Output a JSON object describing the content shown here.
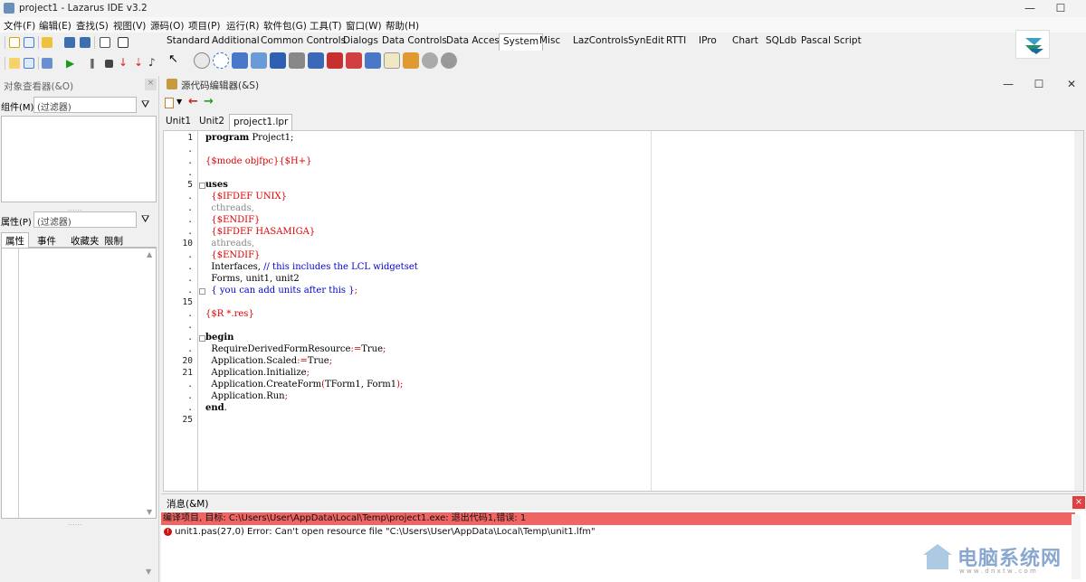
{
  "window": {
    "title": "project1 - Lazarus IDE v3.2"
  },
  "menu": [
    "文件(F)",
    "编辑(E)",
    "查找(S)",
    "视图(V)",
    "源码(O)",
    "项目(P)",
    "运行(R)",
    "软件包(G)",
    "工具(T)",
    "窗口(W)",
    "帮助(H)"
  ],
  "palette_tabs": [
    "Standard",
    "Additional",
    "Common Controls",
    "Dialogs",
    "Data Controls",
    "Data Access",
    "System",
    "Misc",
    "LazControls",
    "SynEdit",
    "RTTI",
    "IPro",
    "Chart",
    "SQLdb",
    "Pascal Script"
  ],
  "palette_active": "System",
  "object_inspector": {
    "title": "对象查看器(&O)",
    "components_label": "组件(M)",
    "filter_placeholder": "(过滤器)",
    "props_label": "属性(P)",
    "tabs": [
      "属性",
      "事件",
      "收藏夹",
      "限制"
    ]
  },
  "editor": {
    "title": "源代码编辑器(&S)",
    "tabs": [
      "Unit1",
      "Unit2",
      "project1.lpr"
    ],
    "active_tab": "project1.lpr",
    "gutter": [
      "1",
      ".",
      ".",
      ".",
      "5",
      ".",
      ".",
      ".",
      ".",
      "10",
      ".",
      ".",
      ".",
      ".",
      "15",
      ".",
      ".",
      ".",
      ".",
      "20",
      "21",
      ".",
      ".",
      ".",
      "25"
    ],
    "lines": [
      [
        {
          "t": "program",
          "c": "kw"
        },
        {
          "t": " Project1;",
          "c": "pl"
        }
      ],
      [],
      [
        {
          "t": "{$mode objfpc}{$H+}",
          "c": "dir"
        }
      ],
      [],
      [
        {
          "t": "uses",
          "c": "kw"
        }
      ],
      [
        {
          "t": "  {$IFDEF UNIX}",
          "c": "dir"
        }
      ],
      [
        {
          "t": "  cthreads,",
          "c": "gray"
        }
      ],
      [
        {
          "t": "  {$ENDIF}",
          "c": "dir"
        }
      ],
      [
        {
          "t": "  {$IFDEF HASAMIGA}",
          "c": "dir"
        }
      ],
      [
        {
          "t": "  athreads,",
          "c": "gray"
        }
      ],
      [
        {
          "t": "  {$ENDIF}",
          "c": "dir"
        }
      ],
      [
        {
          "t": "  Interfaces, ",
          "c": "pl"
        },
        {
          "t": "// this includes the LCL widgetset",
          "c": "cmt"
        }
      ],
      [
        {
          "t": "  Forms, unit1, unit2",
          "c": "pl"
        }
      ],
      [
        {
          "t": "  { you can add units after this }",
          "c": "cmt"
        },
        {
          "t": ";",
          "c": "sym"
        }
      ],
      [],
      [
        {
          "t": "{$R *.res}",
          "c": "dir"
        }
      ],
      [],
      [
        {
          "t": "begin",
          "c": "kw"
        }
      ],
      [
        {
          "t": "  RequireDerivedFormResource",
          "c": "pl"
        },
        {
          "t": ":=",
          "c": "sym"
        },
        {
          "t": "True",
          "c": "pl"
        },
        {
          "t": ";",
          "c": "sym"
        }
      ],
      [
        {
          "t": "  Application.Scaled",
          "c": "pl"
        },
        {
          "t": ":=",
          "c": "sym"
        },
        {
          "t": "True",
          "c": "pl"
        },
        {
          "t": ";",
          "c": "sym"
        }
      ],
      [
        {
          "t": "  Application.Initialize",
          "c": "pl"
        },
        {
          "t": ";",
          "c": "sym"
        }
      ],
      [
        {
          "t": "  Application.CreateForm",
          "c": "pl"
        },
        {
          "t": "(",
          "c": "sym"
        },
        {
          "t": "TForm1, Form1",
          "c": "pl"
        },
        {
          "t": ");",
          "c": "sym"
        }
      ],
      [
        {
          "t": "  Application.Run",
          "c": "pl"
        },
        {
          "t": ";",
          "c": "sym"
        }
      ],
      [
        {
          "t": "end",
          "c": "kw"
        },
        {
          "t": ".",
          "c": "pl"
        }
      ],
      []
    ]
  },
  "messages": {
    "title": "消息(&M)",
    "rows": [
      "编译项目, 目标: C:\\Users\\User\\AppData\\Local\\Temp\\project1.exe: 退出代码1,错误: 1",
      "unit1.pas(27,0) Error: Can't open resource file \"C:\\Users\\User\\AppData\\Local\\Temp\\unit1.lfm\""
    ]
  },
  "watermark": {
    "text": "电脑系统网",
    "url": "w w w . d n x t w . c o m"
  },
  "colors": {
    "error_row": "#f06464",
    "accent": "#0078d7"
  }
}
